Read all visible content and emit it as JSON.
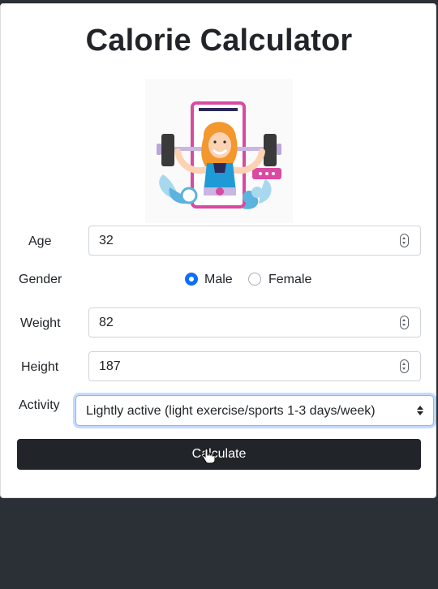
{
  "title": "Calorie Calculator",
  "hero": {
    "icon": "weightlifter-phone-illustration"
  },
  "form": {
    "age": {
      "label": "Age",
      "value": "32"
    },
    "gender": {
      "label": "Gender",
      "options": [
        {
          "label": "Male",
          "checked": true
        },
        {
          "label": "Female",
          "checked": false
        }
      ]
    },
    "weight": {
      "label": "Weight",
      "value": "82"
    },
    "height": {
      "label": "Height",
      "value": "187"
    },
    "activity": {
      "label": "Activity",
      "selected": "Lightly active (light exercise/sports 1-3 days/week)"
    }
  },
  "calculate_label": "Calculate",
  "colors": {
    "accent": "#0d6efd",
    "button": "#212529",
    "background": "#2b2f36"
  }
}
